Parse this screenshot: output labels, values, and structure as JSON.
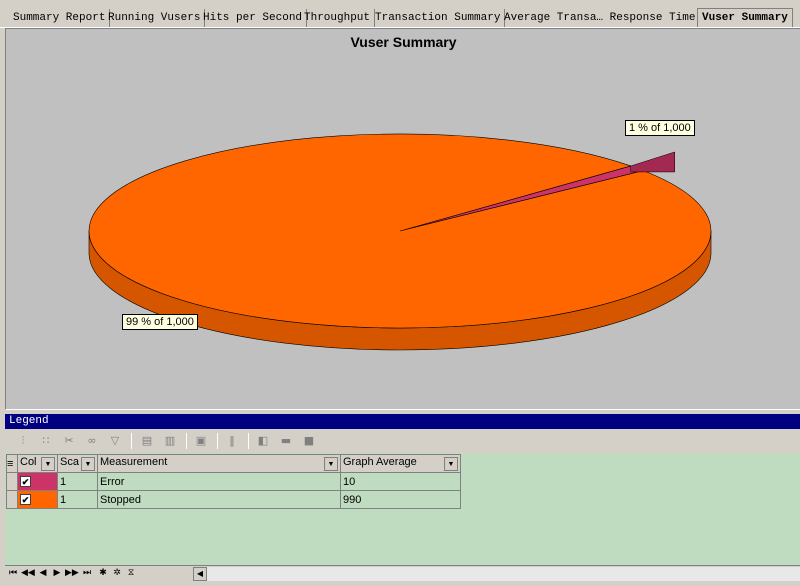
{
  "tabs": [
    {
      "label": "Summary Report"
    },
    {
      "label": "Running Vusers"
    },
    {
      "label": "Hits per Second"
    },
    {
      "label": "Throughput"
    },
    {
      "label": "Transaction Summary"
    },
    {
      "label": "Average Transa… Response Time"
    },
    {
      "label": "Vuser Summary",
      "active": true
    }
  ],
  "chart_data": {
    "type": "pie",
    "title": "Vuser Summary",
    "categories": [
      "Error",
      "Stopped"
    ],
    "values": [
      10,
      990
    ],
    "labels": [
      "1 % of 1,000",
      "99 % of 1,000"
    ],
    "colors": [
      "#cc3366",
      "#ff6600"
    ],
    "legend": "bottom"
  },
  "legend": {
    "header": "Legend",
    "columns": {
      "color": "Col",
      "scale": "Sca",
      "measurement": "Measurement",
      "graph_average": "Graph Average"
    },
    "rows": [
      {
        "color": "#cc3366",
        "checked": "✔",
        "scale": "1",
        "measurement": "Error",
        "graph_average": "10"
      },
      {
        "color": "#ff6600",
        "checked": "✔",
        "scale": "1",
        "measurement": "Stopped",
        "graph_average": "990"
      }
    ]
  },
  "toolbar_icons": [
    "filter-icon",
    "group-icon",
    "cut-icon",
    "link-icon",
    "funnel-icon",
    "left-icon",
    "right-icon",
    "copy-icon",
    "columns-icon",
    "merge-icon",
    "split-icon",
    "box-icon"
  ],
  "navigator": {
    "first": "⏮",
    "prev_page": "◀◀",
    "prev": "◀",
    "next": "▶",
    "next_page": "▶▶",
    "last": "⏭",
    "new": "✱",
    "new_alt": "✲",
    "filter": "⧖"
  }
}
